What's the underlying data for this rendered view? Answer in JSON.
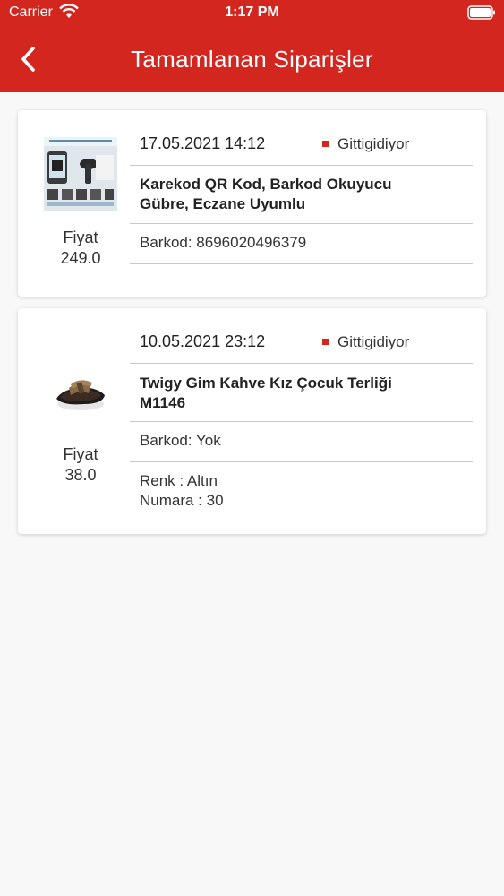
{
  "status_bar": {
    "carrier": "Carrier",
    "time": "1:17 PM"
  },
  "nav": {
    "title": "Tamamlanan Siparişler",
    "back_icon": "chevron-left-icon"
  },
  "colors": {
    "accent": "#d3261f"
  },
  "orders": [
    {
      "date": "17.05.2021 14:12",
      "source": "Gittigidiyor",
      "title_line1": "Karekod QR Kod, Barkod Okuyucu",
      "title_line2": "Gübre, Eczane Uyumlu",
      "barcode": "Barkod: 8696020496379",
      "price_label": "Fiyat",
      "price": "249.0"
    },
    {
      "date": "10.05.2021 23:12",
      "source": "Gittigidiyor",
      "title_line1": "Twigy Gim Kahve Kız Çocuk Terliği",
      "title_line2": "M1146",
      "barcode": "Barkod: Yok",
      "color": "Renk : Altın",
      "size": "Numara : 30",
      "price_label": "Fiyat",
      "price": "38.0"
    }
  ]
}
